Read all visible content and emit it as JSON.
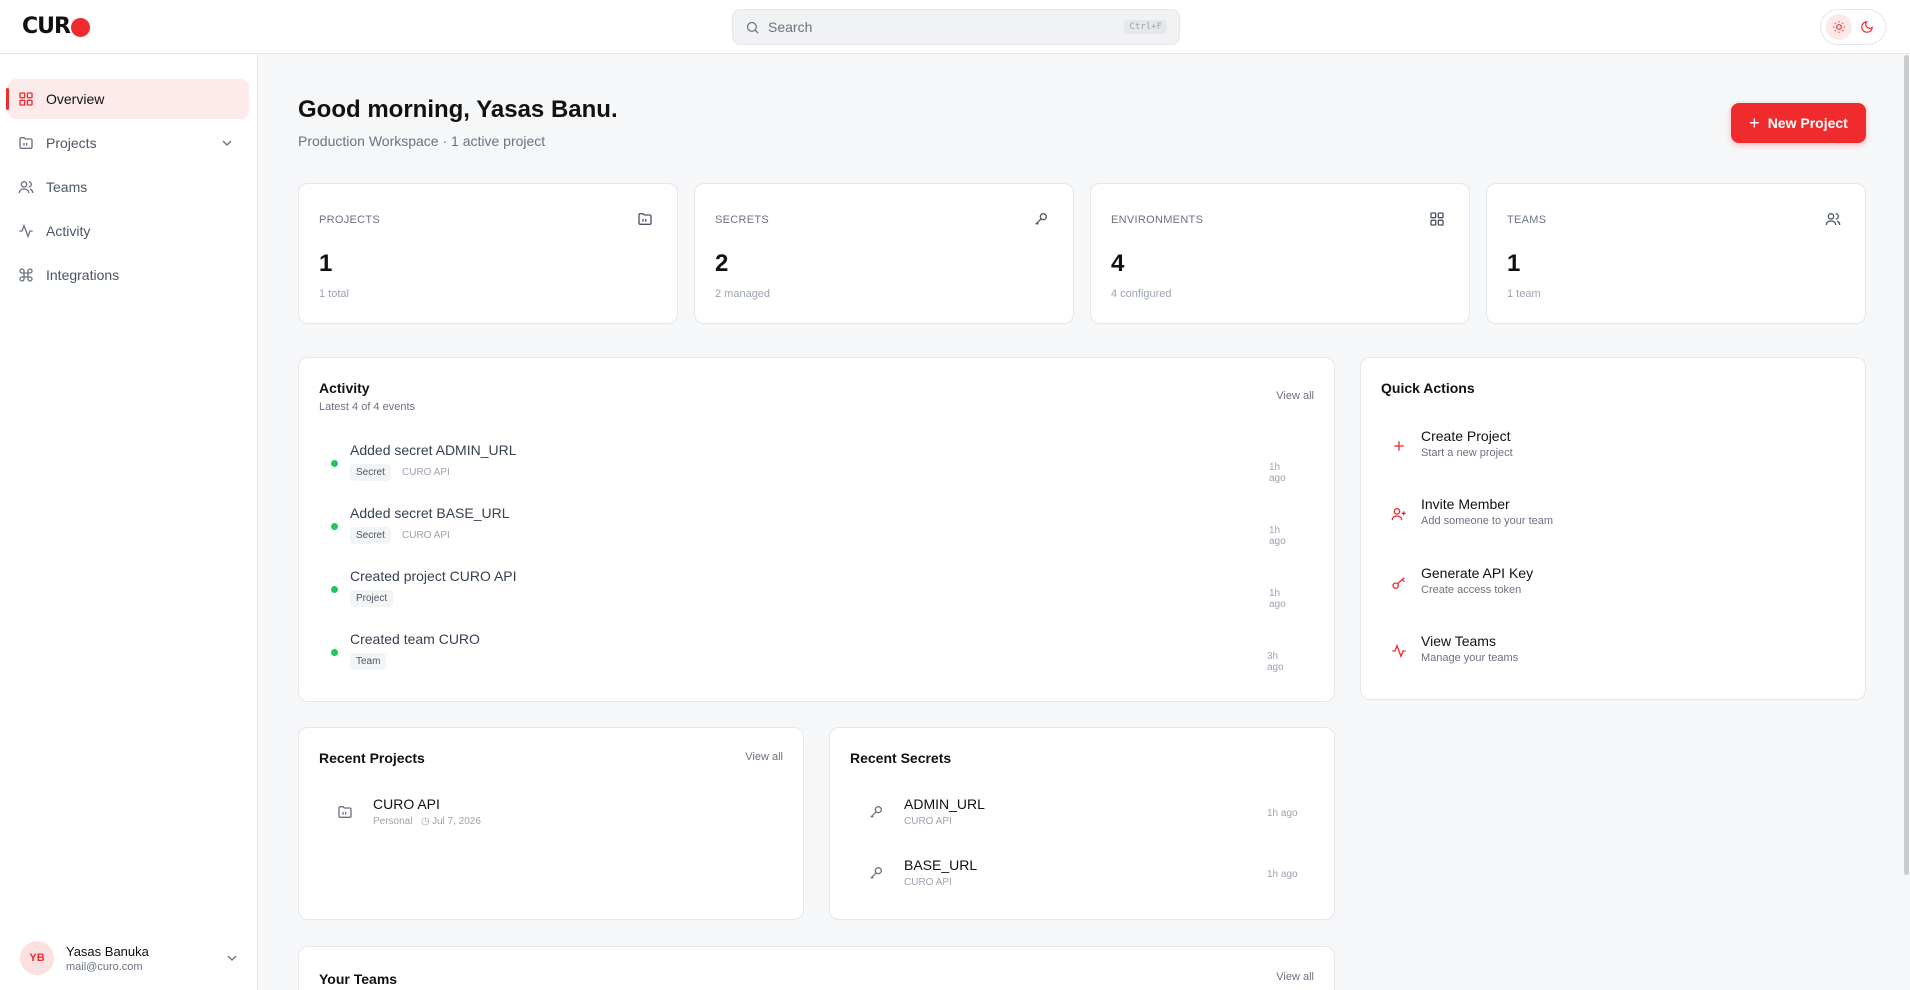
{
  "app": {
    "logo_text": "CUR",
    "logo_o": "O"
  },
  "search": {
    "placeholder": "Search",
    "shortcut": "Ctrl+F"
  },
  "sidebar": {
    "items": [
      {
        "label": "Overview",
        "icon": "grid-icon",
        "active": true
      },
      {
        "label": "Projects",
        "icon": "folder-icon"
      },
      {
        "label": "Teams",
        "icon": "users-icon"
      },
      {
        "label": "Activity",
        "icon": "activity-icon"
      },
      {
        "label": "Integrations",
        "icon": "command-icon"
      }
    ],
    "user": {
      "initials": "YB",
      "name": "Yasas Banuka",
      "email": "mail@curo.com"
    }
  },
  "header": {
    "greeting": "Good morning, Yasas Banu.",
    "subtitle": "Production Workspace · 1 active project",
    "new_project_label": "New Project"
  },
  "stats": [
    {
      "label": "PROJECTS",
      "value": "1",
      "sub": "1 total",
      "icon": "folder-icon"
    },
    {
      "label": "SECRETS",
      "value": "2",
      "sub": "2 managed",
      "icon": "key-icon"
    },
    {
      "label": "ENVIRONMENTS",
      "value": "4",
      "sub": "4 configured",
      "icon": "grid-icon"
    },
    {
      "label": "TEAMS",
      "value": "1",
      "sub": "1 team",
      "icon": "users-icon"
    }
  ],
  "activity": {
    "title": "Activity",
    "subtitle": "Latest 4 of 4 events",
    "view_all": "View all",
    "events": [
      {
        "title": "Added secret ADMIN_URL",
        "tag": "Secret",
        "project": "CURO API",
        "time": "1h ago"
      },
      {
        "title": "Added secret BASE_URL",
        "tag": "Secret",
        "project": "CURO API",
        "time": "1h ago"
      },
      {
        "title": "Created project CURO API",
        "tag": "Project",
        "project": "",
        "time": "1h ago"
      },
      {
        "title": "Created team CURO",
        "tag": "Team",
        "project": "",
        "time": "3h ago"
      }
    ]
  },
  "quick_actions": {
    "title": "Quick Actions",
    "items": [
      {
        "title": "Create Project",
        "sub": "Start a new project",
        "icon": "plus-icon"
      },
      {
        "title": "Invite Member",
        "sub": "Add someone to your team",
        "icon": "user-plus-icon"
      },
      {
        "title": "Generate API Key",
        "sub": "Create access token",
        "icon": "key-icon"
      },
      {
        "title": "View Teams",
        "sub": "Manage your teams",
        "icon": "activity-icon"
      }
    ]
  },
  "recent_projects": {
    "title": "Recent Projects",
    "view_all": "View all",
    "items": [
      {
        "name": "CURO API",
        "owner": "Personal",
        "date": "Jul 7, 2026"
      }
    ]
  },
  "recent_secrets": {
    "title": "Recent Secrets",
    "items": [
      {
        "name": "ADMIN_URL",
        "project": "CURO API",
        "time": "1h ago"
      },
      {
        "name": "BASE_URL",
        "project": "CURO API",
        "time": "1h ago"
      }
    ]
  },
  "your_teams": {
    "title": "Your Teams",
    "view_all": "View all"
  },
  "colors": {
    "accent": "#ef2b2d",
    "success": "#22c55e"
  }
}
